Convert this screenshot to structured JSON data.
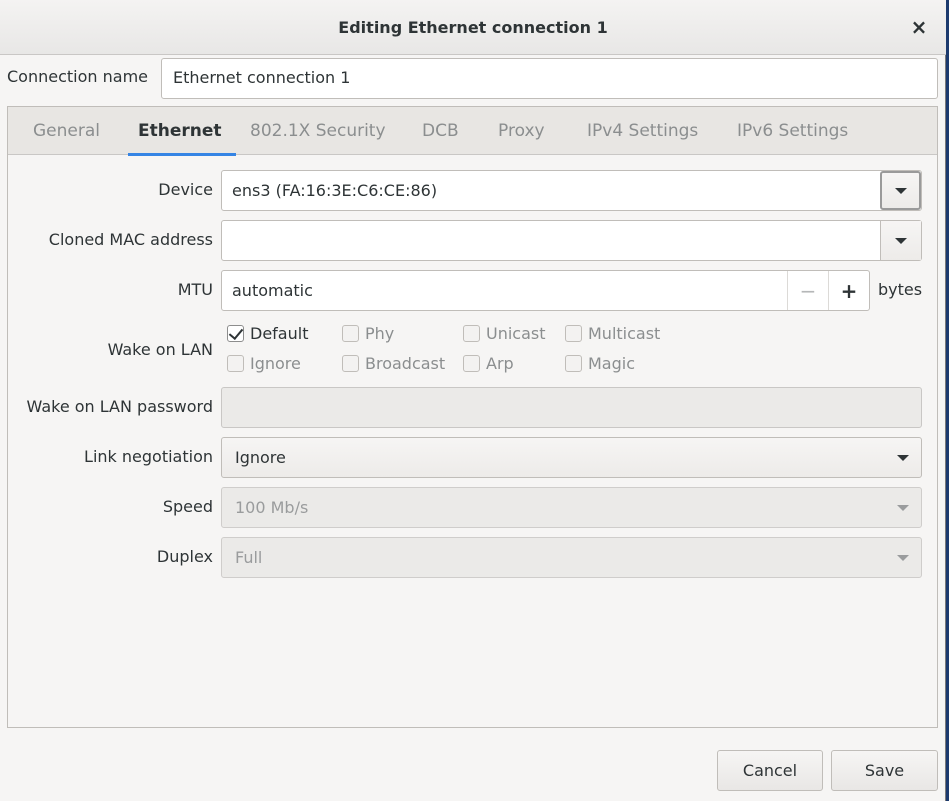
{
  "window": {
    "title": "Editing Ethernet connection 1",
    "close_glyph": "×"
  },
  "connection": {
    "label": "Connection name",
    "value": "Ethernet connection 1"
  },
  "tabs": [
    {
      "label": "General"
    },
    {
      "label": "Ethernet"
    },
    {
      "label": "802.1X Security"
    },
    {
      "label": "DCB"
    },
    {
      "label": "Proxy"
    },
    {
      "label": "IPv4 Settings"
    },
    {
      "label": "IPv6 Settings"
    }
  ],
  "active_tab": "Ethernet",
  "form": {
    "device": {
      "label": "Device",
      "value": "ens3 (FA:16:3E:C6:CE:86)"
    },
    "cloned_mac": {
      "label": "Cloned MAC address",
      "value": ""
    },
    "mtu": {
      "label": "MTU",
      "value": "automatic",
      "minus": "−",
      "plus": "+",
      "units": "bytes"
    },
    "wol": {
      "label": "Wake on LAN",
      "options": [
        {
          "label": "Default",
          "checked": true
        },
        {
          "label": "Phy",
          "checked": false
        },
        {
          "label": "Unicast",
          "checked": false
        },
        {
          "label": "Multicast",
          "checked": false
        },
        {
          "label": "Ignore",
          "checked": false
        },
        {
          "label": "Broadcast",
          "checked": false
        },
        {
          "label": "Arp",
          "checked": false
        },
        {
          "label": "Magic",
          "checked": false
        }
      ]
    },
    "wol_password": {
      "label": "Wake on LAN password",
      "value": ""
    },
    "link_negotiation": {
      "label": "Link negotiation",
      "value": "Ignore"
    },
    "speed": {
      "label": "Speed",
      "value": "100 Mb/s"
    },
    "duplex": {
      "label": "Duplex",
      "value": "Full"
    }
  },
  "footer": {
    "cancel": "Cancel",
    "save": "Save"
  },
  "colors": {
    "accent": "#3584e4",
    "background": "#f6f5f4"
  }
}
